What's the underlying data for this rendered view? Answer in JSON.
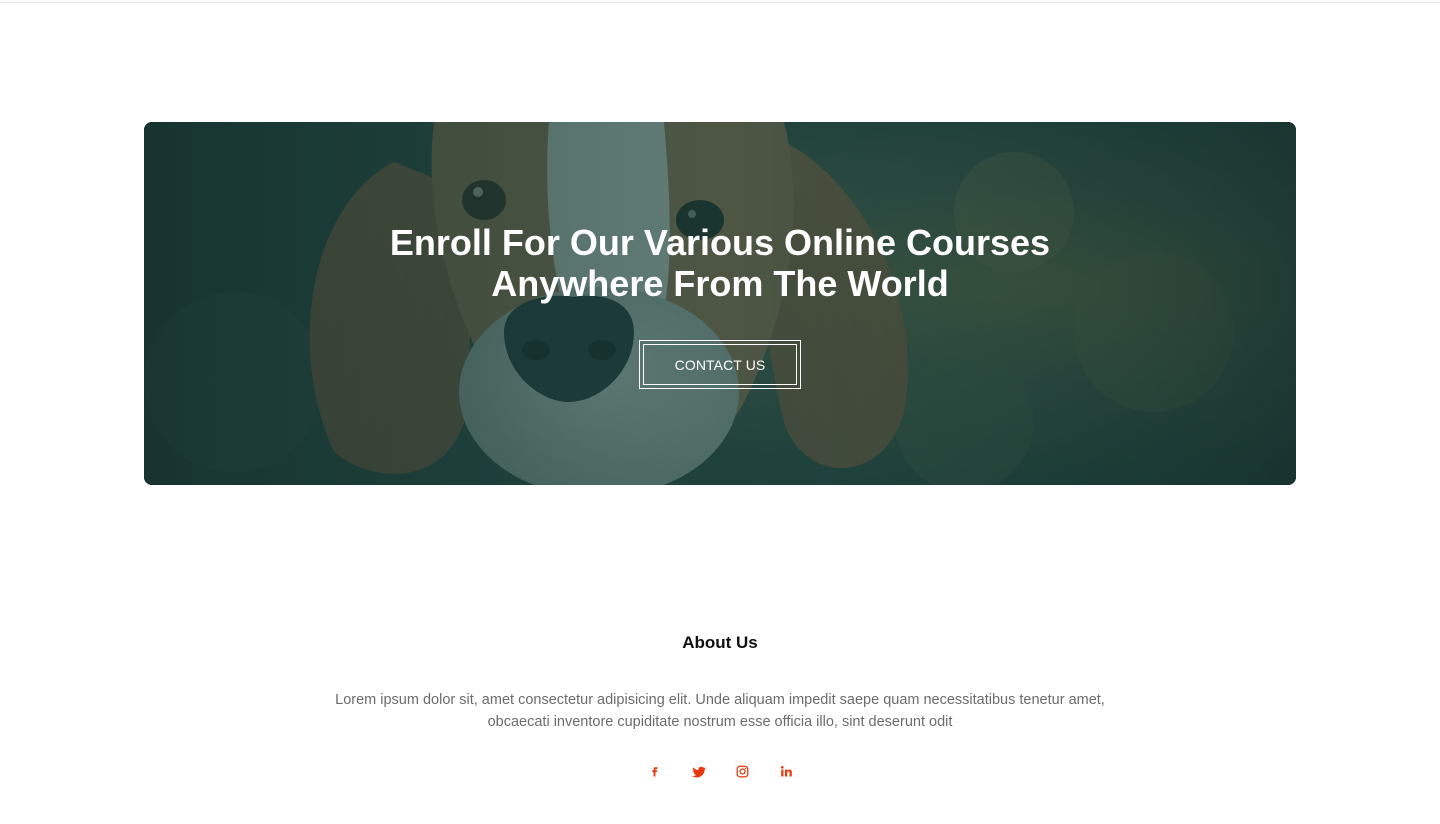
{
  "banner": {
    "title_line1": "Enroll For Our Various Online Courses",
    "title_line2": "Anywhere From The World",
    "button_label": "CONTACT US",
    "overlay_color": "#1f4a44",
    "image_subject": "beagle-dog-photo"
  },
  "about": {
    "heading": "About Us",
    "text": "Lorem ipsum dolor sit, amet consectetur adipisicing elit. Unde aliquam impedit saepe quam necessitatibus tenetur amet, obcaecati inventore cupiditate nostrum esse officia illo, sint deserunt odit"
  },
  "socials": {
    "accent_color": "#e8380d",
    "icons": [
      "facebook-icon",
      "twitter-icon",
      "instagram-icon",
      "linkedin-icon"
    ]
  }
}
